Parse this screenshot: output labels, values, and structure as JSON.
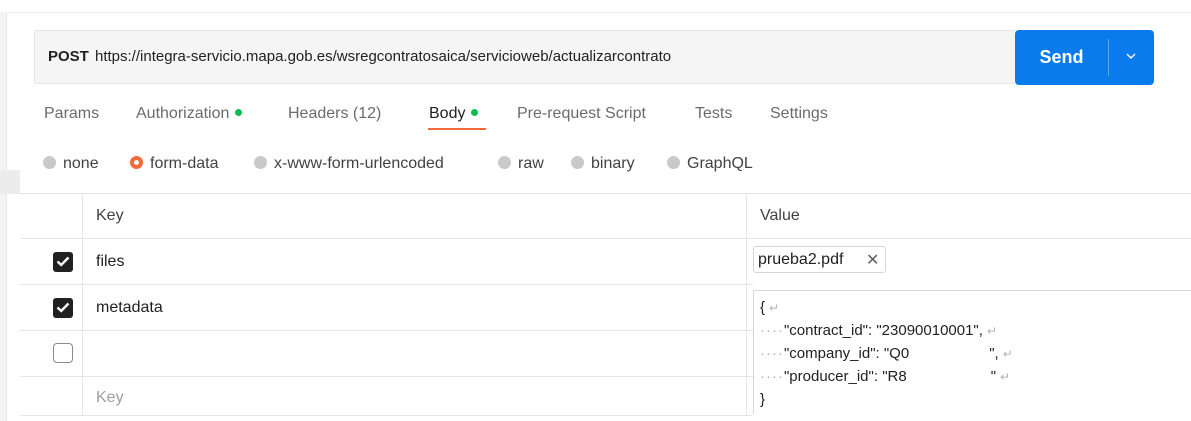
{
  "request": {
    "method": "POST",
    "url": "https://integra-servicio.mapa.gob.es/wsregcontratosaica/servicioweb/actualizarcontrato"
  },
  "send_button": {
    "label": "Send"
  },
  "tabs": [
    {
      "label": "Params",
      "dot": false,
      "active": false
    },
    {
      "label": "Authorization",
      "dot": true,
      "active": false
    },
    {
      "label": "Headers (12)",
      "dot": false,
      "active": false
    },
    {
      "label": "Body",
      "dot": true,
      "active": true
    },
    {
      "label": "Pre-request Script",
      "dot": false,
      "active": false
    },
    {
      "label": "Tests",
      "dot": false,
      "active": false
    },
    {
      "label": "Settings",
      "dot": false,
      "active": false
    }
  ],
  "body_types": [
    {
      "label": "none",
      "selected": false
    },
    {
      "label": "form-data",
      "selected": true
    },
    {
      "label": "x-www-form-urlencoded",
      "selected": false
    },
    {
      "label": "raw",
      "selected": false
    },
    {
      "label": "binary",
      "selected": false
    },
    {
      "label": "GraphQL",
      "selected": false
    }
  ],
  "table": {
    "headers": {
      "key": "Key",
      "value": "Value"
    },
    "rows": [
      {
        "checked": true,
        "key": "files",
        "value_file": "prueba2.pdf"
      },
      {
        "checked": true,
        "key": "metadata"
      },
      {
        "checked": false,
        "key": ""
      }
    ],
    "new_row_key_placeholder": "Key",
    "metadata_value_lines": [
      {
        "text": "{"
      },
      {
        "prefix": "····",
        "text": "\"contract_id\": \"23090010001\","
      },
      {
        "prefix": "····",
        "text_a": "\"company_id\": \"Q0",
        "text_b": "\","
      },
      {
        "prefix": "····",
        "text_a": "\"producer_id\": \"R8",
        "text_b": "\""
      },
      {
        "text": "}"
      }
    ]
  },
  "colors": {
    "send_button": "#097bed",
    "active_tab_underline": "#f26b3a",
    "status_dot": "#0cbb52",
    "selected_radio": "#f26b3a"
  },
  "icons": [
    "chevron-down-icon",
    "close-icon",
    "checkmark-icon",
    "newline-icon"
  ]
}
